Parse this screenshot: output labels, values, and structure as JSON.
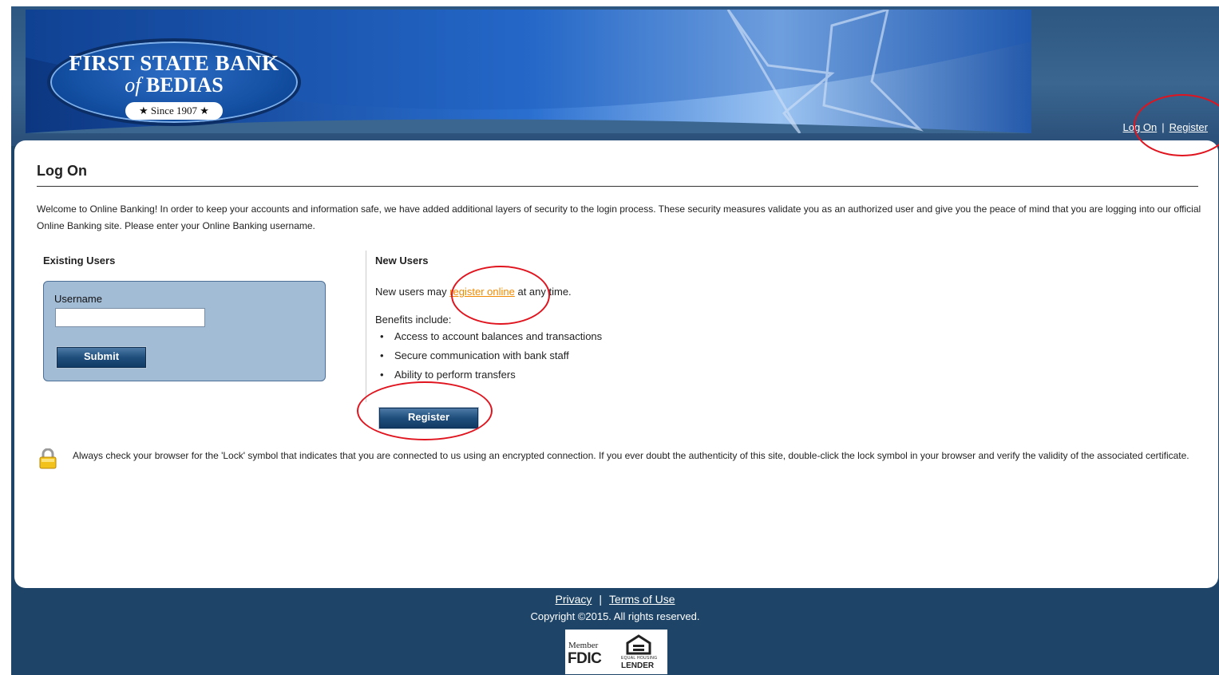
{
  "bank": {
    "name_line1": "FIRST STATE BANK",
    "name_of": "of",
    "name_line2": "BEDIAS",
    "since": "★ Since 1907 ★"
  },
  "header_nav": {
    "logon_label": "Log On",
    "separator": "|",
    "register_label": "Register"
  },
  "page": {
    "title": "Log On",
    "intro": "Welcome to Online Banking! In order to keep your accounts and information safe, we have added additional layers of security to the login process. These security measures validate you as an authorized user and give you the peace of mind that you are logging into our official Online Banking site. Please enter your Online Banking username."
  },
  "existing_users": {
    "heading": "Existing Users",
    "username_label": "Username",
    "username_value": "",
    "submit_label": "Submit"
  },
  "new_users": {
    "heading": "New Users",
    "text_before": "New users may ",
    "link_label": "register online",
    "text_after": " at any time.",
    "benefits_label": "Benefits include:",
    "benefits": [
      "Access to account balances and transactions",
      "Secure communication with bank staff",
      "Ability to perform transfers"
    ],
    "register_button_label": "Register"
  },
  "security_note": "Always check your browser for the 'Lock' symbol that indicates that you are connected to us using an encrypted connection. If you ever doubt the authenticity of this site, double-click the lock symbol in your browser and verify the validity of the associated certificate.",
  "footer": {
    "privacy_label": "Privacy",
    "separator": "|",
    "terms_label": "Terms of Use",
    "copyright": "Copyright ©2015. All rights reserved.",
    "fdic_member": "Member",
    "fdic": "FDIC",
    "ehl_top": "EQUAL HOUSING",
    "ehl_bottom": "LENDER"
  },
  "colors": {
    "frame": "#1e4568",
    "login_box": "#a3bcd6",
    "button": "#1f4e7c",
    "link_orange": "#f08a00",
    "annotation_red": "#e0141e"
  }
}
